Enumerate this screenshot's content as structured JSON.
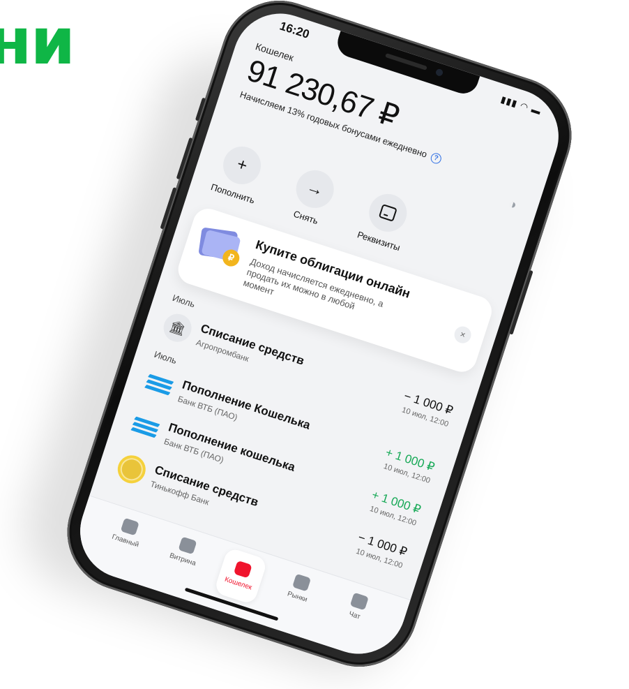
{
  "brand": {
    "fragment": "ни",
    "color": "#0fb646"
  },
  "status_bar": {
    "time": "16:20",
    "icons": "wifi-icon battery-icon"
  },
  "header": {
    "title": "Кошелек",
    "balance": "91 230,67 ₽",
    "bonus_text": "Начисляем 13% годовых бонусами ежедневно",
    "help_glyph": "?"
  },
  "actions": [
    {
      "label": "Пополнить",
      "icon": "plus-icon",
      "glyph": "+"
    },
    {
      "label": "Снять",
      "icon": "arrow-right-icon",
      "glyph": "→"
    },
    {
      "label": "Реквизиты",
      "icon": "details-icon",
      "glyph": ""
    }
  ],
  "promo": {
    "title": "Купите облигации онлайн",
    "text": "Доход начисляется ежедневно, а продать их можно в любой момент",
    "close_glyph": "×",
    "coin_glyph": "₽"
  },
  "transactions": {
    "month_1": "Июль",
    "month_2": "Июль",
    "items": [
      {
        "name": "Списание средств",
        "bank": "Агропромбанк",
        "amount": "− 1 000 ₽",
        "date": "10 июл, 12:00",
        "icon": "bank-building-icon"
      },
      {
        "name": "Пополнение Кошелька",
        "bank": "Банк ВТБ (ПАО)",
        "amount": "+ 1 000 ₽",
        "date": "10 июл, 12:00",
        "icon": "vtb-logo-icon"
      },
      {
        "name": "Пополнение кошелька",
        "bank": "Банк ВТБ (ПАО)",
        "amount": "+ 1 000 ₽",
        "date": "10 июл, 12:00",
        "icon": "vtb-logo-icon"
      },
      {
        "name": "Списание средств",
        "bank": "Тинькофф Банк",
        "amount": "− 1 000 ₽",
        "date": "10 июл, 12:00",
        "icon": "tinkoff-logo-icon"
      }
    ]
  },
  "tabbar": {
    "tabs": [
      {
        "label": "Главный",
        "icon": "home-icon"
      },
      {
        "label": "Витрина",
        "icon": "showcase-icon"
      },
      {
        "label": "Кошелек",
        "icon": "wallet-icon",
        "active": true
      },
      {
        "label": "Рынки",
        "icon": "markets-icon"
      },
      {
        "label": "Чат",
        "icon": "chat-icon"
      }
    ]
  },
  "colors": {
    "accent_red": "#f0142d",
    "positive_green": "#18a957",
    "help_blue": "#2f6fe4"
  }
}
